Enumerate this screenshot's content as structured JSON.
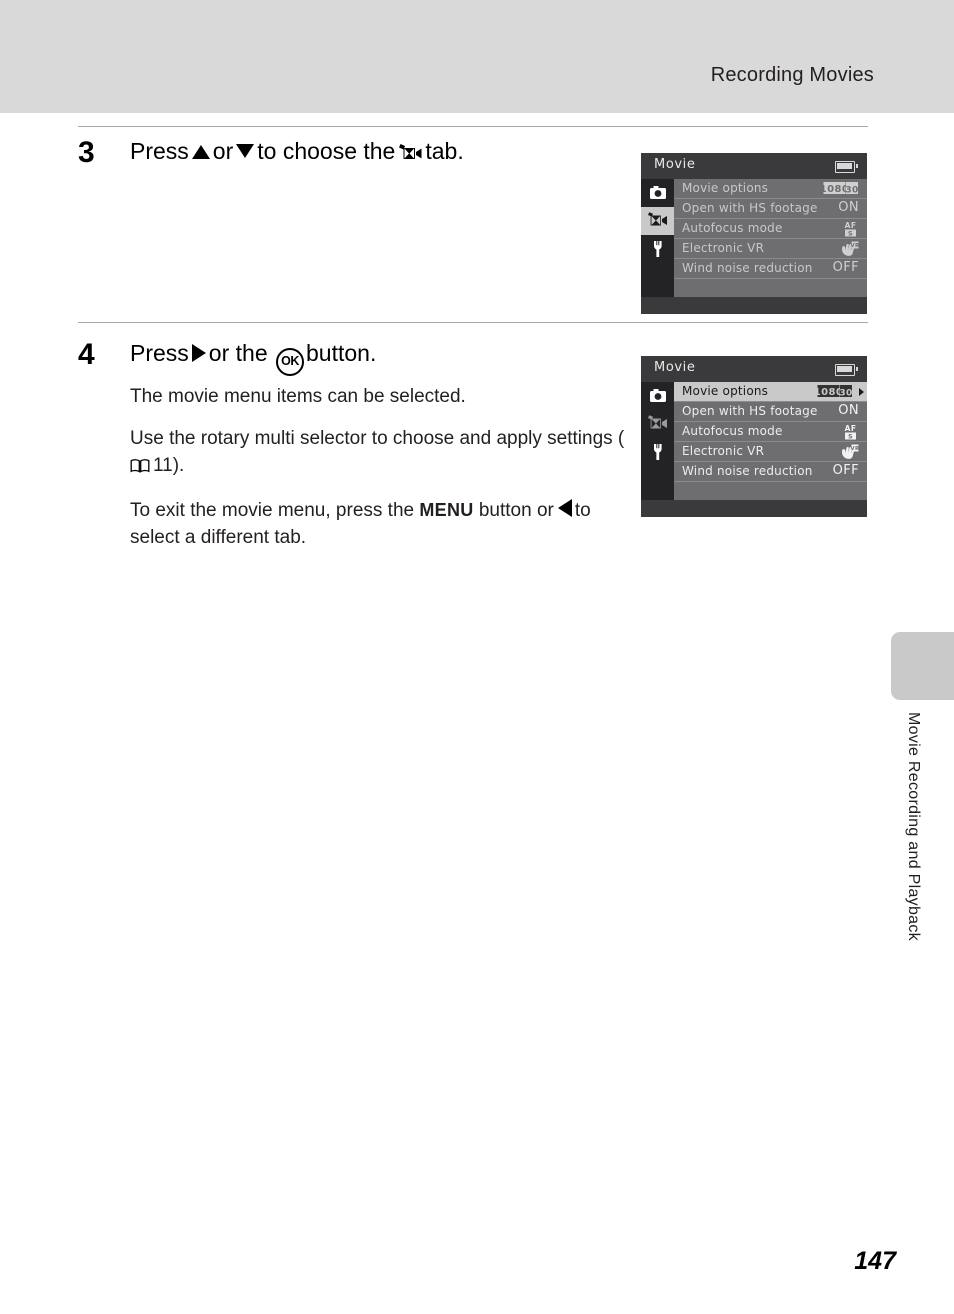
{
  "header": {
    "title": "Recording Movies"
  },
  "steps": [
    {
      "number": "3",
      "heading_parts": {
        "a": "Press",
        "or": "or",
        "b": "to choose the",
        "c": "tab."
      },
      "icons": [
        "up-triangle",
        "down-triangle",
        "movie-camera"
      ]
    },
    {
      "number": "4",
      "heading_parts": {
        "a": "Press",
        "or": "or the",
        "b": "button."
      },
      "ok_label": "OK",
      "paragraphs": {
        "p1": "The movie menu items can be selected.",
        "p2_a": "Use the rotary multi selector to choose and apply settings (",
        "p2_ref": "11",
        "p2_b": ").",
        "p3_a": "To exit the movie menu, press the",
        "p3_menu": "MENU",
        "p3_b": "button or",
        "p3_c": "to select a different tab."
      }
    }
  ],
  "camera_screens": [
    {
      "title": "Movie",
      "state": "inactive",
      "tabs": [
        {
          "name": "shooting-tab",
          "selected": false
        },
        {
          "name": "movie-tab",
          "selected": true
        },
        {
          "name": "setup-tab",
          "selected": false
        }
      ],
      "rows": [
        {
          "label": "Movie options",
          "value": "1080 star",
          "value_type": "badge-1080",
          "highlighted": false
        },
        {
          "label": "Open with HS footage",
          "value": "ON",
          "value_type": "text",
          "highlighted": false
        },
        {
          "label": "Autofocus mode",
          "value": "AF-S",
          "value_type": "icon-afs",
          "highlighted": false
        },
        {
          "label": "Electronic VR",
          "value": "VR",
          "value_type": "icon-vr",
          "highlighted": false
        },
        {
          "label": "Wind noise reduction",
          "value": "OFF",
          "value_type": "text",
          "highlighted": false
        }
      ]
    },
    {
      "title": "Movie",
      "state": "active",
      "tabs": [
        {
          "name": "shooting-tab",
          "selected": false
        },
        {
          "name": "movie-tab",
          "selected": false
        },
        {
          "name": "setup-tab",
          "selected": false
        }
      ],
      "rows": [
        {
          "label": "Movie options",
          "value": "1080 star",
          "value_type": "badge-1080",
          "highlighted": true
        },
        {
          "label": "Open with HS footage",
          "value": "ON",
          "value_type": "text",
          "highlighted": false
        },
        {
          "label": "Autofocus mode",
          "value": "AF-S",
          "value_type": "icon-afs",
          "highlighted": false
        },
        {
          "label": "Electronic VR",
          "value": "VR",
          "value_type": "icon-vr",
          "highlighted": false
        },
        {
          "label": "Wind noise reduction",
          "value": "OFF",
          "value_type": "text",
          "highlighted": false
        }
      ]
    }
  ],
  "side_tab": {
    "label": "Movie Recording and Playback"
  },
  "footer": {
    "page_number": "147"
  },
  "colors": {
    "header_band": "#d9d9d9",
    "screen_frame": "#3a3a3c",
    "screen_tabs_bg": "#232325",
    "screen_menu_bg": "#6e6e70",
    "highlight": "#c9c9c9"
  }
}
